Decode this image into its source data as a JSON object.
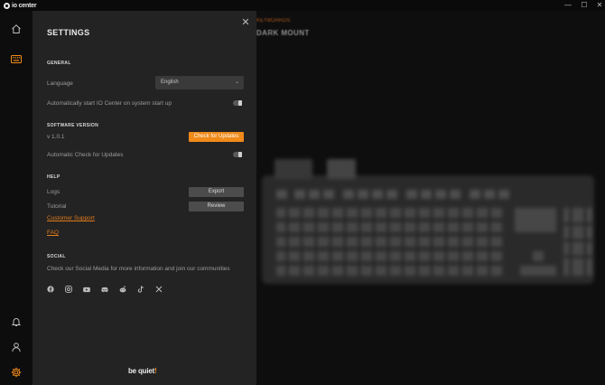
{
  "window": {
    "title": "io center",
    "minimize": "—",
    "maximize": "☐",
    "close": "✕"
  },
  "nav": {
    "icons": [
      "home-icon",
      "keyboard-icon",
      "bell-icon",
      "user-icon",
      "gear-icon"
    ],
    "accent": "#f08a19"
  },
  "background": {
    "breadcrumb": "KEYBOARDS",
    "device_title": "DARK MOUNT"
  },
  "settings": {
    "title": "SETTINGS",
    "close": "✕",
    "general": {
      "heading": "GENERAL",
      "language_label": "Language",
      "language_value": "English",
      "autostart_label": "Automatically start IO Center on system start up"
    },
    "software": {
      "heading": "SOFTWARE VERSION",
      "version": "v 1.0.1",
      "check_button": "Check for Updates",
      "auto_check_label": "Automatic Check for Updates"
    },
    "help": {
      "heading": "HELP",
      "logs_label": "Logs",
      "export_button": "Export",
      "tutorial_label": "Tutorial",
      "review_button": "Review",
      "support_link": "Customer Support",
      "faq_link": "FAQ"
    },
    "social": {
      "heading": "SOCIAL",
      "text": "Check our Social Media for more information and join our communities",
      "icons": [
        "facebook-icon",
        "instagram-icon",
        "youtube-icon",
        "discord-icon",
        "reddit-icon",
        "tiktok-icon",
        "x-icon"
      ]
    },
    "brand": {
      "text": "be quiet",
      "bang": "!"
    }
  }
}
